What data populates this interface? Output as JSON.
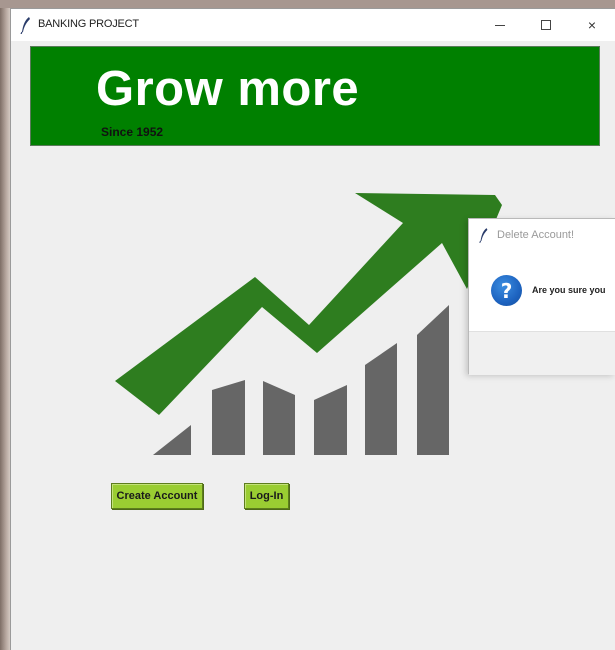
{
  "window": {
    "title": "BANKING PROJECT",
    "icon": "feather-icon",
    "controls": {
      "minimize": "minimize-icon",
      "maximize": "maximize-icon",
      "close": "×"
    }
  },
  "banner": {
    "title": "Grow more",
    "subtitle": "Since 1952",
    "color": "#008000"
  },
  "graphic": {
    "icon": "growth-chart-icon",
    "arrow_color": "#2e7d1f",
    "bar_color": "#666666"
  },
  "buttons": {
    "create_account": "Create Account",
    "login": "Log-In",
    "color": "#9acd32"
  },
  "dialog": {
    "title": "Delete Account!",
    "icon": "question-icon",
    "question_mark": "?",
    "message": "Are you sure you"
  }
}
